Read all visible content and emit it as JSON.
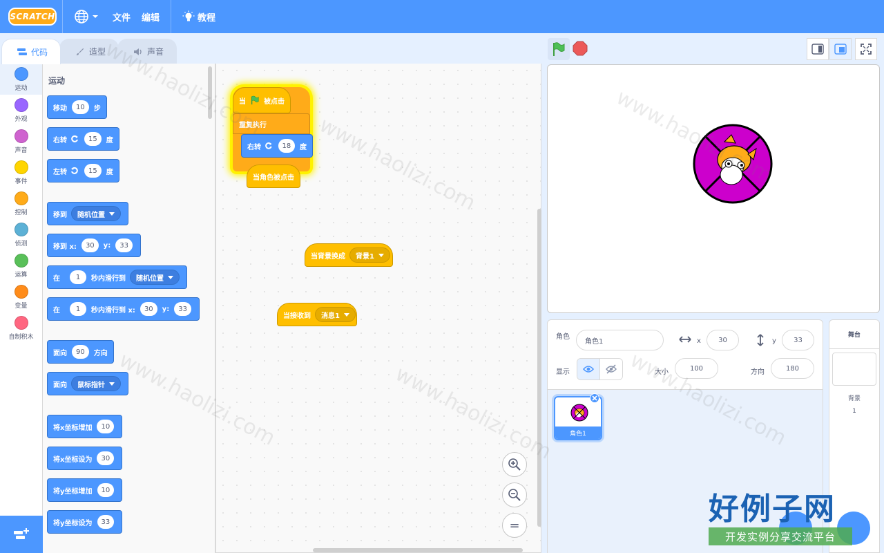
{
  "menubar": {
    "logo": "SCRATCH",
    "file": "文件",
    "edit": "编辑",
    "tutorials": "教程"
  },
  "tabs": [
    "代码",
    "造型",
    "声音"
  ],
  "categories": [
    {
      "label": "运动",
      "color": "#4c97ff"
    },
    {
      "label": "外观",
      "color": "#9966ff"
    },
    {
      "label": "声音",
      "color": "#cf63cf"
    },
    {
      "label": "事件",
      "color": "#ffd500"
    },
    {
      "label": "控制",
      "color": "#ffab19"
    },
    {
      "label": "侦测",
      "color": "#5cb1d6"
    },
    {
      "label": "运算",
      "color": "#59c059"
    },
    {
      "label": "变量",
      "color": "#ff8c1a"
    },
    {
      "label": "自制积木",
      "color": "#ff6680"
    }
  ],
  "palette": {
    "title": "运动",
    "move": {
      "a": "移动",
      "v": "10",
      "b": "步"
    },
    "turn_right": {
      "a": "右转",
      "v": "15",
      "b": "度"
    },
    "turn_left": {
      "a": "左转",
      "v": "15",
      "b": "度"
    },
    "goto": {
      "a": "移到",
      "dd": "随机位置"
    },
    "goto_xy": {
      "a": "移到 x:",
      "x": "30",
      "y_label": "y:",
      "y": "33"
    },
    "glide": {
      "a": "在",
      "v": "1",
      "b": "秒内滑行到",
      "dd": "随机位置"
    },
    "glide_xy": {
      "a": "在",
      "v": "1",
      "b": "秒内滑行到 x:",
      "x": "30",
      "y_label": "y:",
      "y": "33"
    },
    "point_dir": {
      "a": "面向",
      "v": "90",
      "b": "方向"
    },
    "point_towards": {
      "a": "面向",
      "dd": "鼠标指针"
    },
    "change_x": {
      "a": "将x坐标增加",
      "v": "10"
    },
    "set_x": {
      "a": "将x坐标设为",
      "v": "30"
    },
    "change_y": {
      "a": "将y坐标增加",
      "v": "10"
    },
    "set_y": {
      "a": "将y坐标设为",
      "v": "33"
    }
  },
  "script": {
    "when_flag_a": "当",
    "when_flag_b": "被点击",
    "forever": "重复执行",
    "turn": {
      "a": "右转",
      "v": "18",
      "b": "度"
    },
    "sprite_clicked": "当角色被点击",
    "backdrop_switch": {
      "a": "当背景换成",
      "dd": "背景1"
    },
    "receive": {
      "a": "当接收到",
      "dd": "消息1"
    }
  },
  "zoom": {
    "in": "+",
    "out": "−",
    "reset": "="
  },
  "sprite_info": {
    "sprite_label": "角色",
    "sprite_name": "角色1",
    "x_label": "x",
    "x": "30",
    "y_label": "y",
    "y": "33",
    "show_label": "显示",
    "size_label": "大小",
    "size": "100",
    "direction_label": "方向",
    "direction": "180"
  },
  "sprites": [
    {
      "name": "角色1"
    }
  ],
  "stage_panel": {
    "title": "舞台",
    "backdrops_label": "背景",
    "backdrops_count": "1"
  },
  "watermark": {
    "site": "www.haolizi.com",
    "brand": "好例子网",
    "tagline": "开发实例分享交流平台"
  },
  "colors": {
    "accent": "#4c97ff",
    "motion": "#4c97ff",
    "events": "#ffbf00",
    "control": "#ffab19",
    "sprite_costume": "#cc00cc"
  }
}
